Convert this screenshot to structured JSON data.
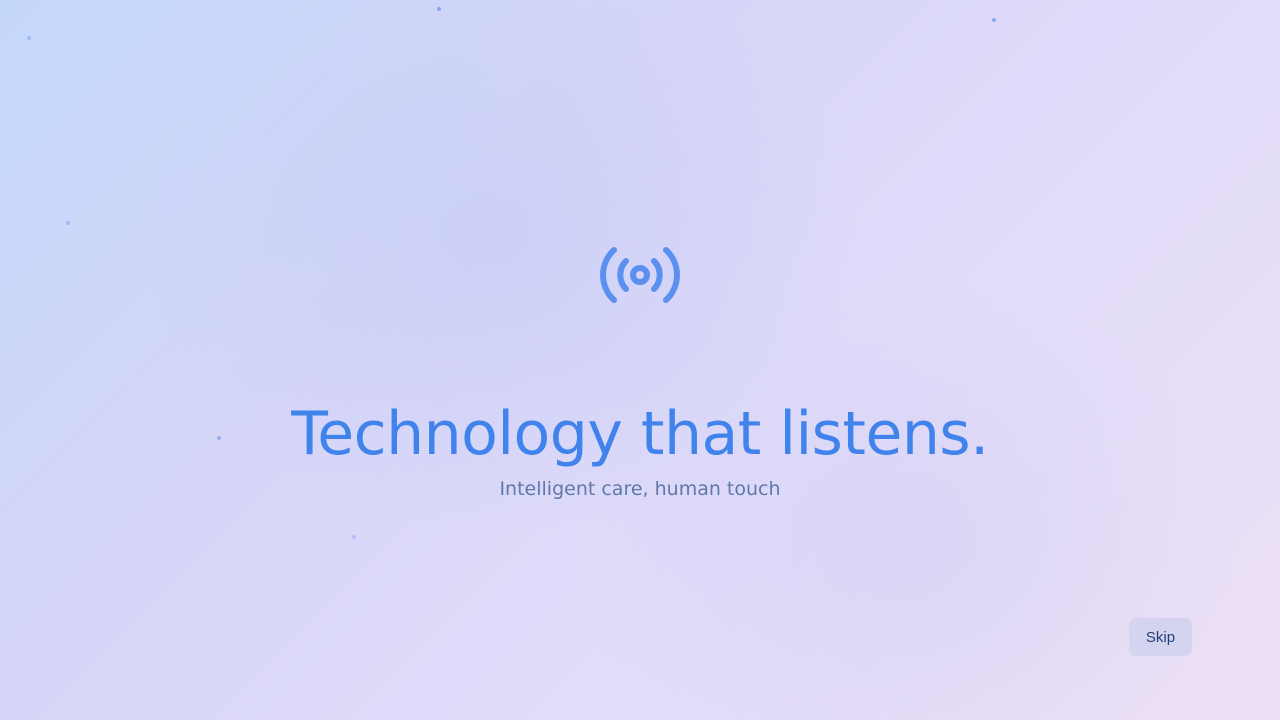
{
  "splash": {
    "icon": "broadcast-signal-icon",
    "headline": "Technology that listens.",
    "subtitle": "Intelligent care, human touch",
    "skip_label": "Skip"
  },
  "colors": {
    "accent": "#4183ec",
    "subtitle": "#5f79ab",
    "button_text": "#23407a",
    "background_start": "#c4d8fb",
    "background_end": "#ece0f6"
  }
}
